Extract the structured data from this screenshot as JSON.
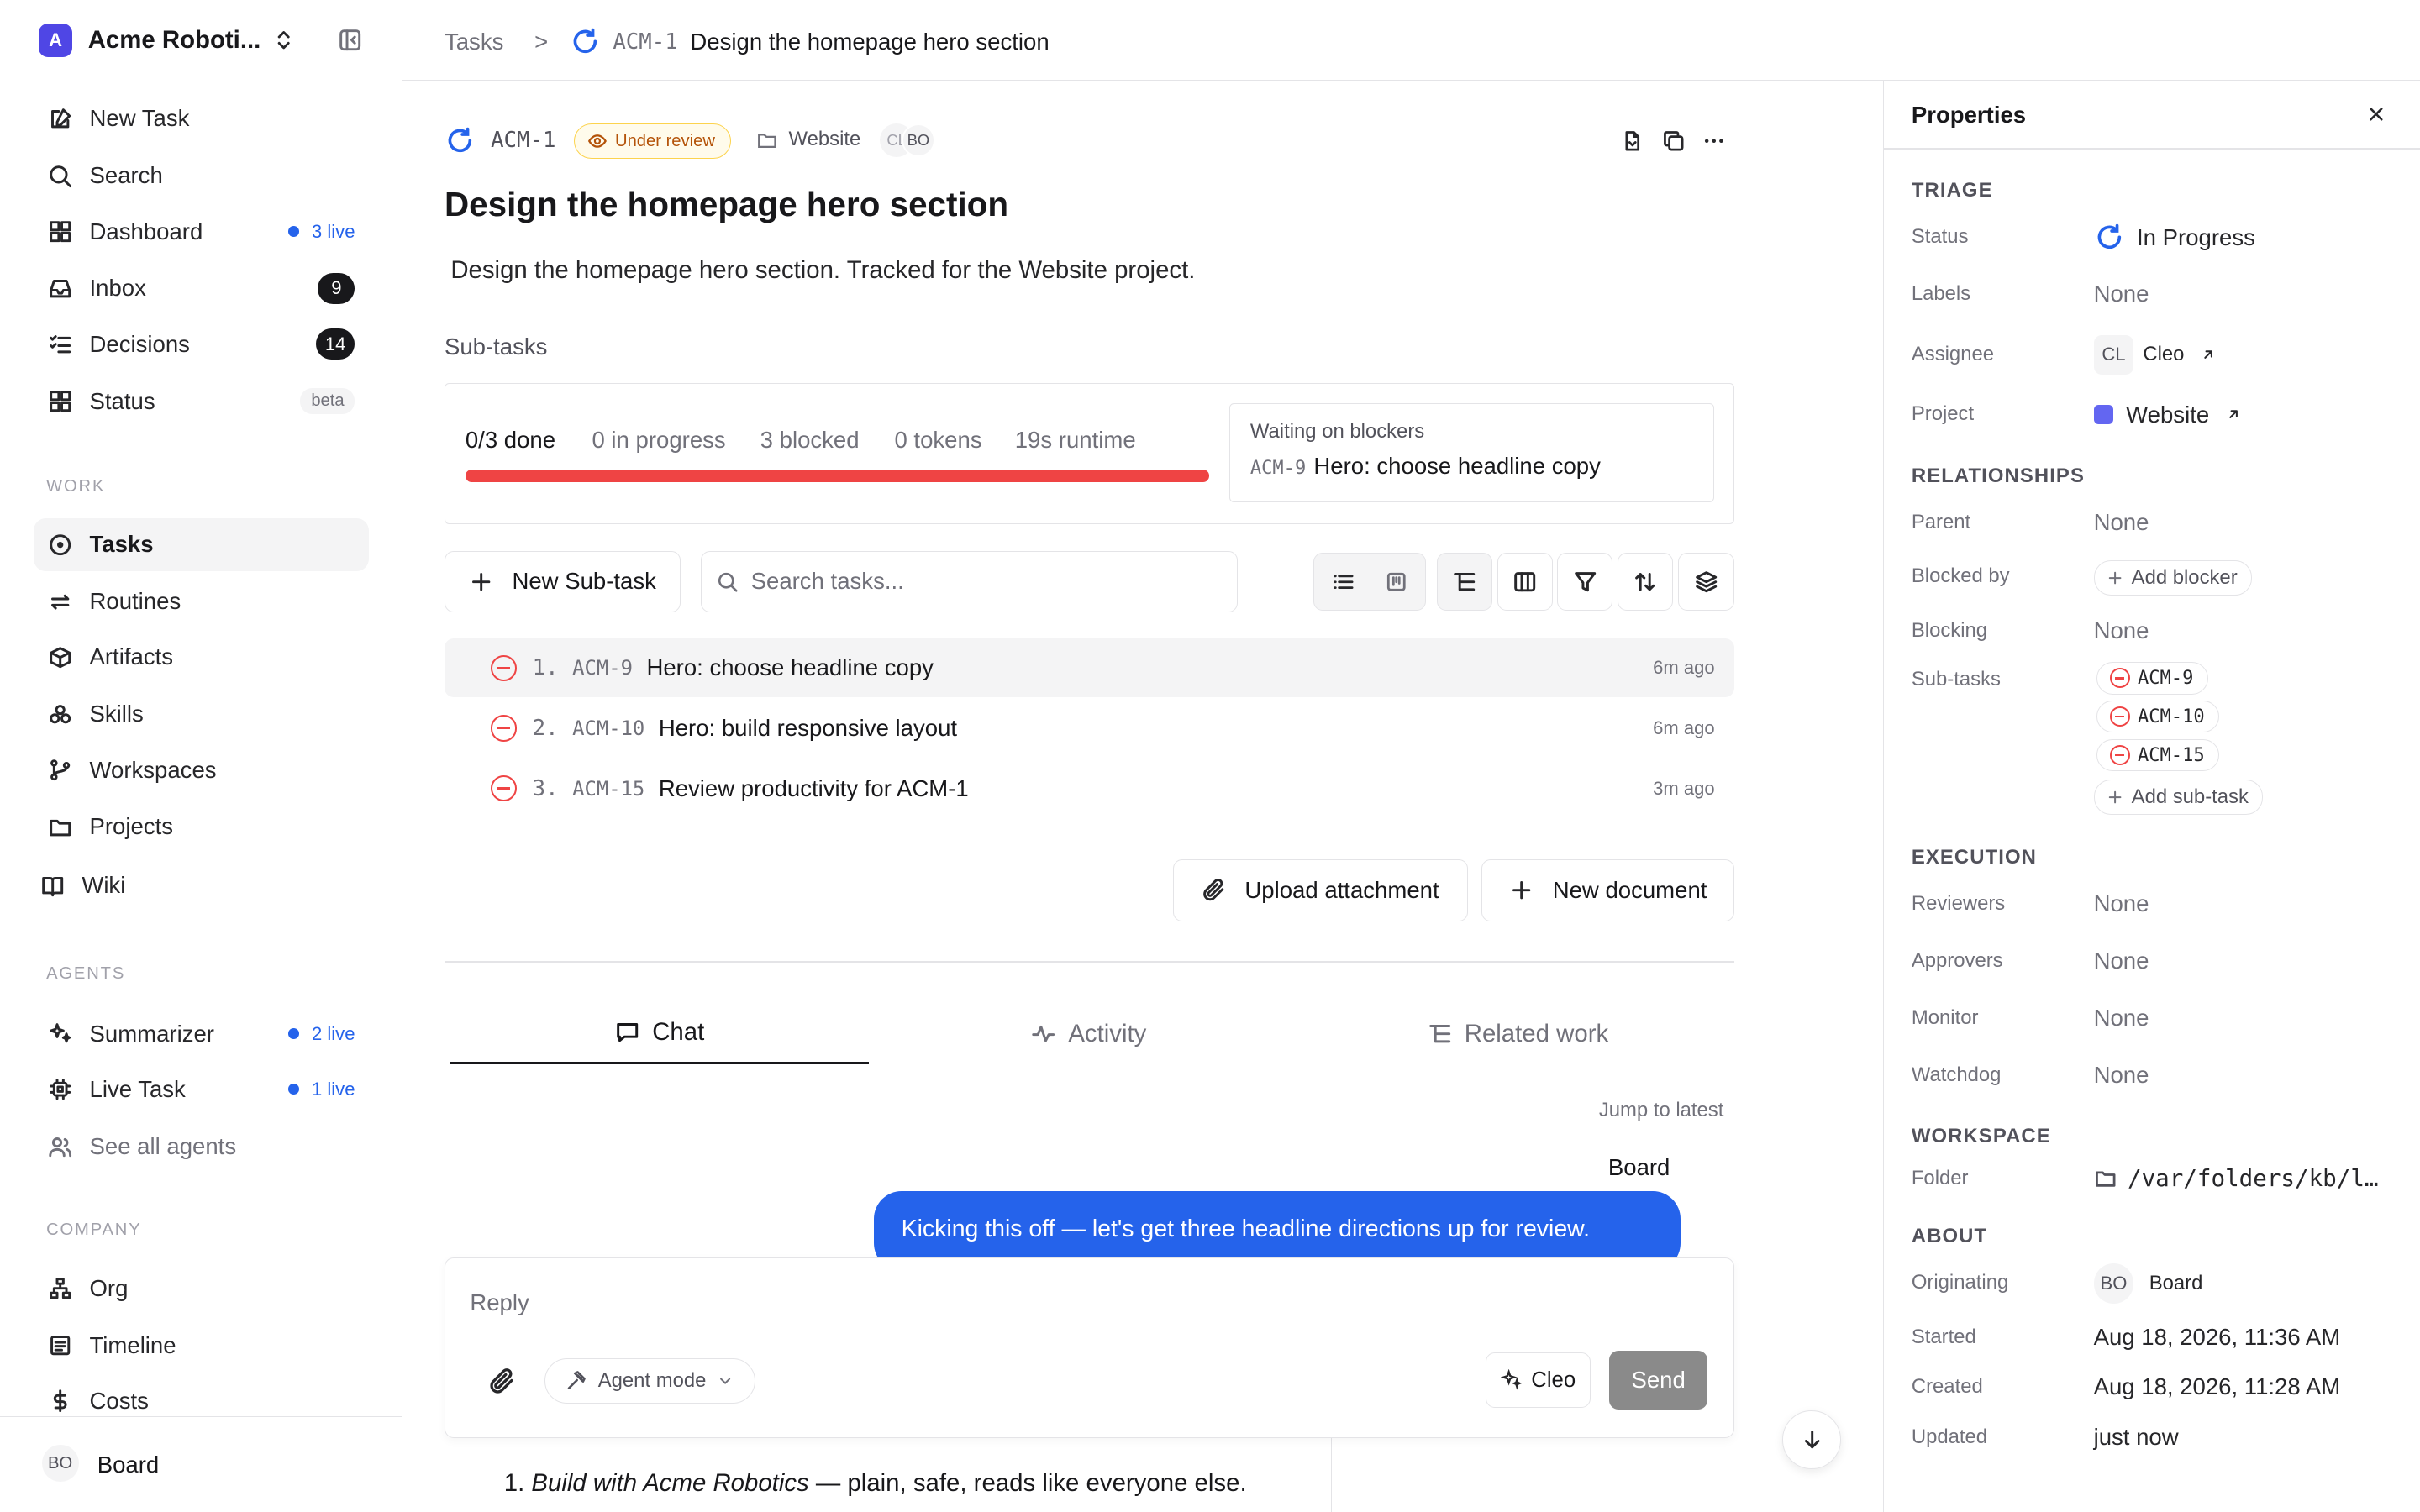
{
  "workspace": {
    "initial": "A",
    "name": "Acme Roboti..."
  },
  "sidebar": {
    "top_items": [
      {
        "label": "New Task"
      },
      {
        "label": "Search"
      },
      {
        "label": "Dashboard",
        "live": "3 live"
      },
      {
        "label": "Inbox",
        "count": "9"
      },
      {
        "label": "Decisions",
        "count": "14"
      },
      {
        "label": "Status",
        "tag": "beta"
      }
    ],
    "work_label": "WORK",
    "work_items": [
      {
        "label": "Tasks"
      },
      {
        "label": "Routines"
      },
      {
        "label": "Artifacts"
      },
      {
        "label": "Skills"
      },
      {
        "label": "Workspaces"
      },
      {
        "label": "Projects"
      },
      {
        "label": "Wiki"
      }
    ],
    "agents_label": "AGENTS",
    "agents": [
      {
        "label": "Summarizer",
        "live": "2 live"
      },
      {
        "label": "Live Task",
        "live": "1 live"
      },
      {
        "label": "See all agents"
      }
    ],
    "company_label": "COMPANY",
    "company_items": [
      {
        "label": "Org"
      },
      {
        "label": "Timeline"
      },
      {
        "label": "Costs"
      }
    ],
    "user": {
      "initials": "BO",
      "name": "Board"
    }
  },
  "breadcrumb": {
    "root": "Tasks",
    "sep": ">",
    "key": "ACM‑1",
    "title": "Design the homepage hero section"
  },
  "task": {
    "key": "ACM‑1",
    "status_chip": "Under review",
    "project": "Website",
    "assignee_initials": [
      "CL",
      "BO"
    ],
    "title": "Design the homepage hero section",
    "description": "Design the homepage hero section. Tracked for the Website project."
  },
  "subtasks": {
    "heading": "Sub-tasks",
    "stats": {
      "done": "0/3 done",
      "in_progress": "0 in progress",
      "blocked": "3 blocked",
      "tokens": "0 tokens",
      "runtime": "19s runtime"
    },
    "progress_fraction": 1.0,
    "blockers_title": "Waiting on blockers",
    "blocker_key": "ACM‑9",
    "blocker_title": "Hero: choose headline copy",
    "new_label": "New Sub-task",
    "search_placeholder": "Search tasks...",
    "rows": [
      {
        "num": "1.",
        "key": "ACM‑9",
        "title": "Hero: choose headline copy",
        "age": "6m ago"
      },
      {
        "num": "2.",
        "key": "ACM‑10",
        "title": "Hero: build responsive layout",
        "age": "6m ago"
      },
      {
        "num": "3.",
        "key": "ACM‑15",
        "title": "Review productivity for ACM-1",
        "age": "3m ago"
      }
    ],
    "upload_label": "Upload attachment",
    "new_doc_label": "New document"
  },
  "tabs": [
    {
      "label": "Chat",
      "icon": "chat-icon"
    },
    {
      "label": "Activity",
      "icon": "activity-icon"
    },
    {
      "label": "Related work",
      "icon": "related-icon"
    }
  ],
  "chat": {
    "jump_label": "Jump to latest",
    "sender": "Board",
    "message": "Kicking this off — let's get three headline directions up for review.",
    "reply_placeholder": "Reply",
    "agent_mode": "Agent mode",
    "agent_name": "Cleo",
    "send": "Send",
    "list_num": "1.",
    "list_item_em": "Build with Acme Robotics",
    "list_item_rest": " — plain, safe, reads like everyone else."
  },
  "properties": {
    "title": "Properties",
    "triage": "TRIAGE",
    "status_label": "Status",
    "status_value": "In Progress",
    "labels_label": "Labels",
    "labels_value": "None",
    "assignee_label": "Assignee",
    "assignee_initials": "CL",
    "assignee_value": "Cleo",
    "project_label": "Project",
    "project_value": "Website",
    "relationships": "RELATIONSHIPS",
    "parent_label": "Parent",
    "parent_value": "None",
    "blocked_by_label": "Blocked by",
    "add_blocker": "Add blocker",
    "blocking_label": "Blocking",
    "blocking_value": "None",
    "subtasks_label": "Sub-tasks",
    "subtask_pills": [
      "ACM‑9",
      "ACM‑10",
      "ACM‑15"
    ],
    "add_subtask": "Add sub-task",
    "execution": "EXECUTION",
    "reviewers_label": "Reviewers",
    "reviewers_value": "None",
    "approvers_label": "Approvers",
    "approvers_value": "None",
    "monitor_label": "Monitor",
    "monitor_value": "None",
    "watchdog_label": "Watchdog",
    "watchdog_value": "None",
    "workspace": "WORKSPACE",
    "folder_label": "Folder",
    "folder_value": "/var/folders/kb/l…",
    "about": "ABOUT",
    "originating_label": "Originating",
    "originating_initials": "BO",
    "originating_value": "Board",
    "started_label": "Started",
    "started_value": "Aug 18, 2026, 11:36 AM",
    "created_label": "Created",
    "created_value": "Aug 18, 2026, 11:28 AM",
    "updated_label": "Updated",
    "updated_value": "just now"
  },
  "colors": {
    "accent": "#2563eb",
    "danger": "#ef4444",
    "project": "#6366f1",
    "review": "#b45309"
  }
}
